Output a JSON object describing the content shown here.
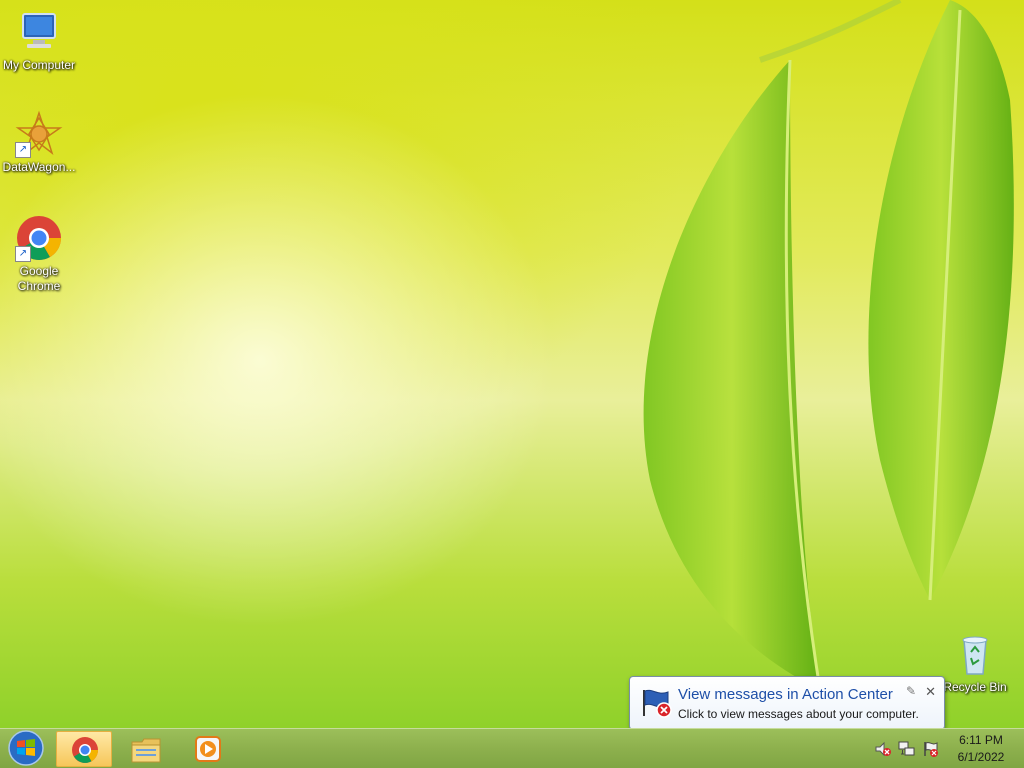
{
  "desktop": {
    "icons": [
      {
        "label": "My Computer",
        "icon": "computer-icon"
      },
      {
        "label": "DataWagon...",
        "icon": "datawagon-icon"
      },
      {
        "label": "Google Chrome",
        "icon": "chrome-icon"
      },
      {
        "label": "Recycle Bin",
        "icon": "recycle-bin-icon"
      }
    ]
  },
  "notification": {
    "title": "View messages in Action Center",
    "body": "Click to view messages about your computer.",
    "close_label": "✕",
    "icon": "action-center-flag-icon"
  },
  "taskbar": {
    "start_icon": "windows-logo-icon",
    "pinned": [
      {
        "name": "chrome",
        "icon": "chrome-icon",
        "active": true
      },
      {
        "name": "explorer",
        "icon": "folder-icon",
        "active": false
      },
      {
        "name": "media-player",
        "icon": "media-player-icon",
        "active": false
      }
    ],
    "tray": [
      "volume-muted-icon",
      "network-icon",
      "action-center-flag-icon"
    ],
    "clock": {
      "time": "6:11 PM",
      "date": "6/1/2022"
    }
  },
  "colors": {
    "taskbar": "#8db04d",
    "wallpaper_yellow": "#d4e019",
    "wallpaper_green": "#8fd12a",
    "notify_title": "#1e4fa8"
  }
}
